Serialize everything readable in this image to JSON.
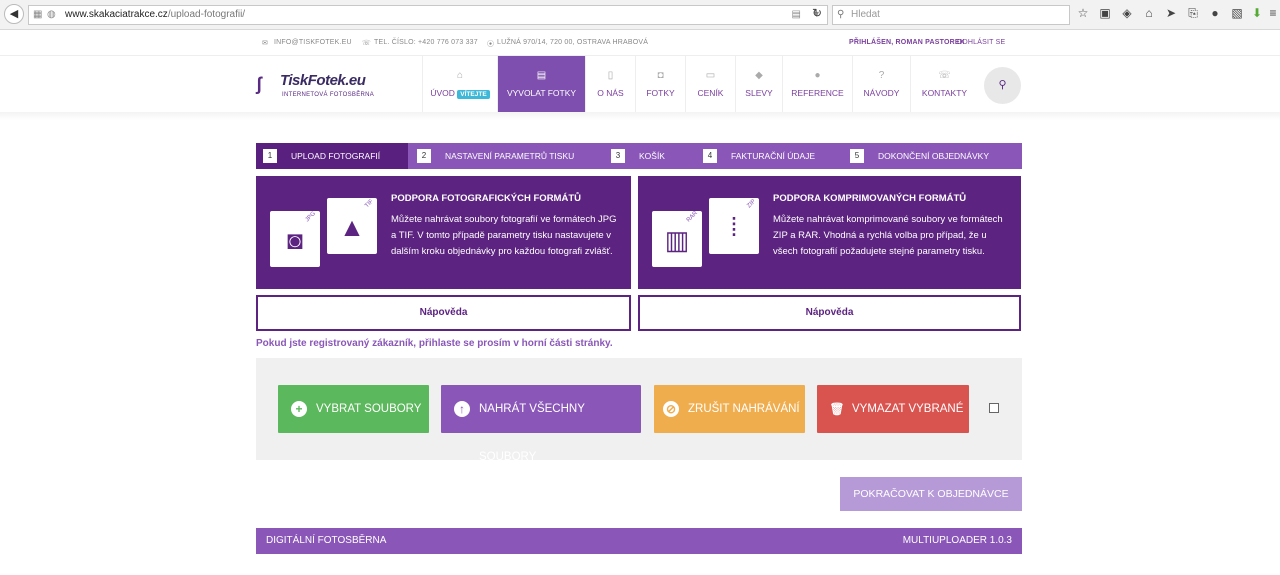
{
  "browser": {
    "back_icon": "back-arrow-icon",
    "url_host": "www.skakaciatrakce.cz",
    "url_path": "/upload-fotografii/",
    "search_placeholder": "Hledat"
  },
  "topbar": {
    "email": "INFO@TISKFOTEK.EU",
    "phone": "TEL. ČÍSLO: +420 776 073 337",
    "address": "LUŽNÁ 970/14, 720 00, OSTRAVA HRABOVÁ",
    "logged_in": "PŘIHLÁŠEN, ROMAN PASTOREK",
    "logout": "ODHLÁSIT SE"
  },
  "logo": {
    "name": "TiskFotek.eu",
    "tagline": "INTERNETOVÁ  FOTOSBĚRNA"
  },
  "nav": {
    "items": [
      {
        "label": "ÚVOD",
        "badge": "VÍTEJTE",
        "icon": "home-icon"
      },
      {
        "label": "VYVOLAT FOTKY",
        "icon": "printer-icon",
        "active": true
      },
      {
        "label": "O NÁS",
        "icon": "phone-icon"
      },
      {
        "label": "FOTKY",
        "icon": "camera-icon"
      },
      {
        "label": "CENÍK",
        "icon": "list-icon"
      },
      {
        "label": "SLEVY",
        "icon": "tag-icon"
      },
      {
        "label": "REFERENCE",
        "icon": "comment-icon"
      },
      {
        "label": "NÁVODY",
        "icon": "question-icon"
      },
      {
        "label": "KONTAKTY",
        "icon": "phone-icon"
      }
    ],
    "search_icon": "search-icon"
  },
  "steps": [
    {
      "num": "1",
      "label": "UPLOAD FOTOGRAFIÍ",
      "active": true
    },
    {
      "num": "2",
      "label": "NASTAVENÍ PARAMETRŮ TISKU"
    },
    {
      "num": "3",
      "label": "KOŠÍK"
    },
    {
      "num": "4",
      "label": "FAKTURAČNÍ ÚDAJE"
    },
    {
      "num": "5",
      "label": "DOKONČENÍ OBJEDNÁVKY"
    }
  ],
  "info_left": {
    "title": "PODPORA FOTOGRAFICKÝCH FORMÁTŮ",
    "text": "Můžete nahrávat soubory fotografií ve formátech JPG a TIF. V tomto případě parametry tisku nastavujete v dalším kroku objednávky pro každou fotografi zvlášť.",
    "tag1": "JPG",
    "tag2": "TIF",
    "help": "Nápověda"
  },
  "info_right": {
    "title": "PODPORA KOMPRIMOVANÝCH FORMÁTŮ",
    "text": "Můžete nahrávat komprimované soubory ve formátech ZIP a RAR. Vhodná a rychlá volba pro případ, že u všech fotografií požadujete stejné parametry tisku.",
    "tag1": "RAR",
    "tag2": "ZIP",
    "help": "Nápověda"
  },
  "reg_note": "Pokud jste registrovaný zákazník, přihlaste se prosím v horní části stránky.",
  "actions": {
    "select": "VYBRAT SOUBORY",
    "upload": "NAHRÁT VŠECHNY SOUBORY",
    "cancel": "ZRUŠIT NAHRÁVÁNÍ",
    "delete": "VYMAZAT VYBRANÉ",
    "colors": {
      "select": "#5cb85c",
      "upload": "#8a57b8",
      "cancel": "#f0ad4e",
      "delete": "#d9534f"
    }
  },
  "continue": "POKRAČOVAT K OBJEDNÁVCE",
  "footer": {
    "left": "DIGITÁLNÍ FOTOSBĚRNA",
    "right": "MULTIUPLOADER 1.0.3"
  }
}
